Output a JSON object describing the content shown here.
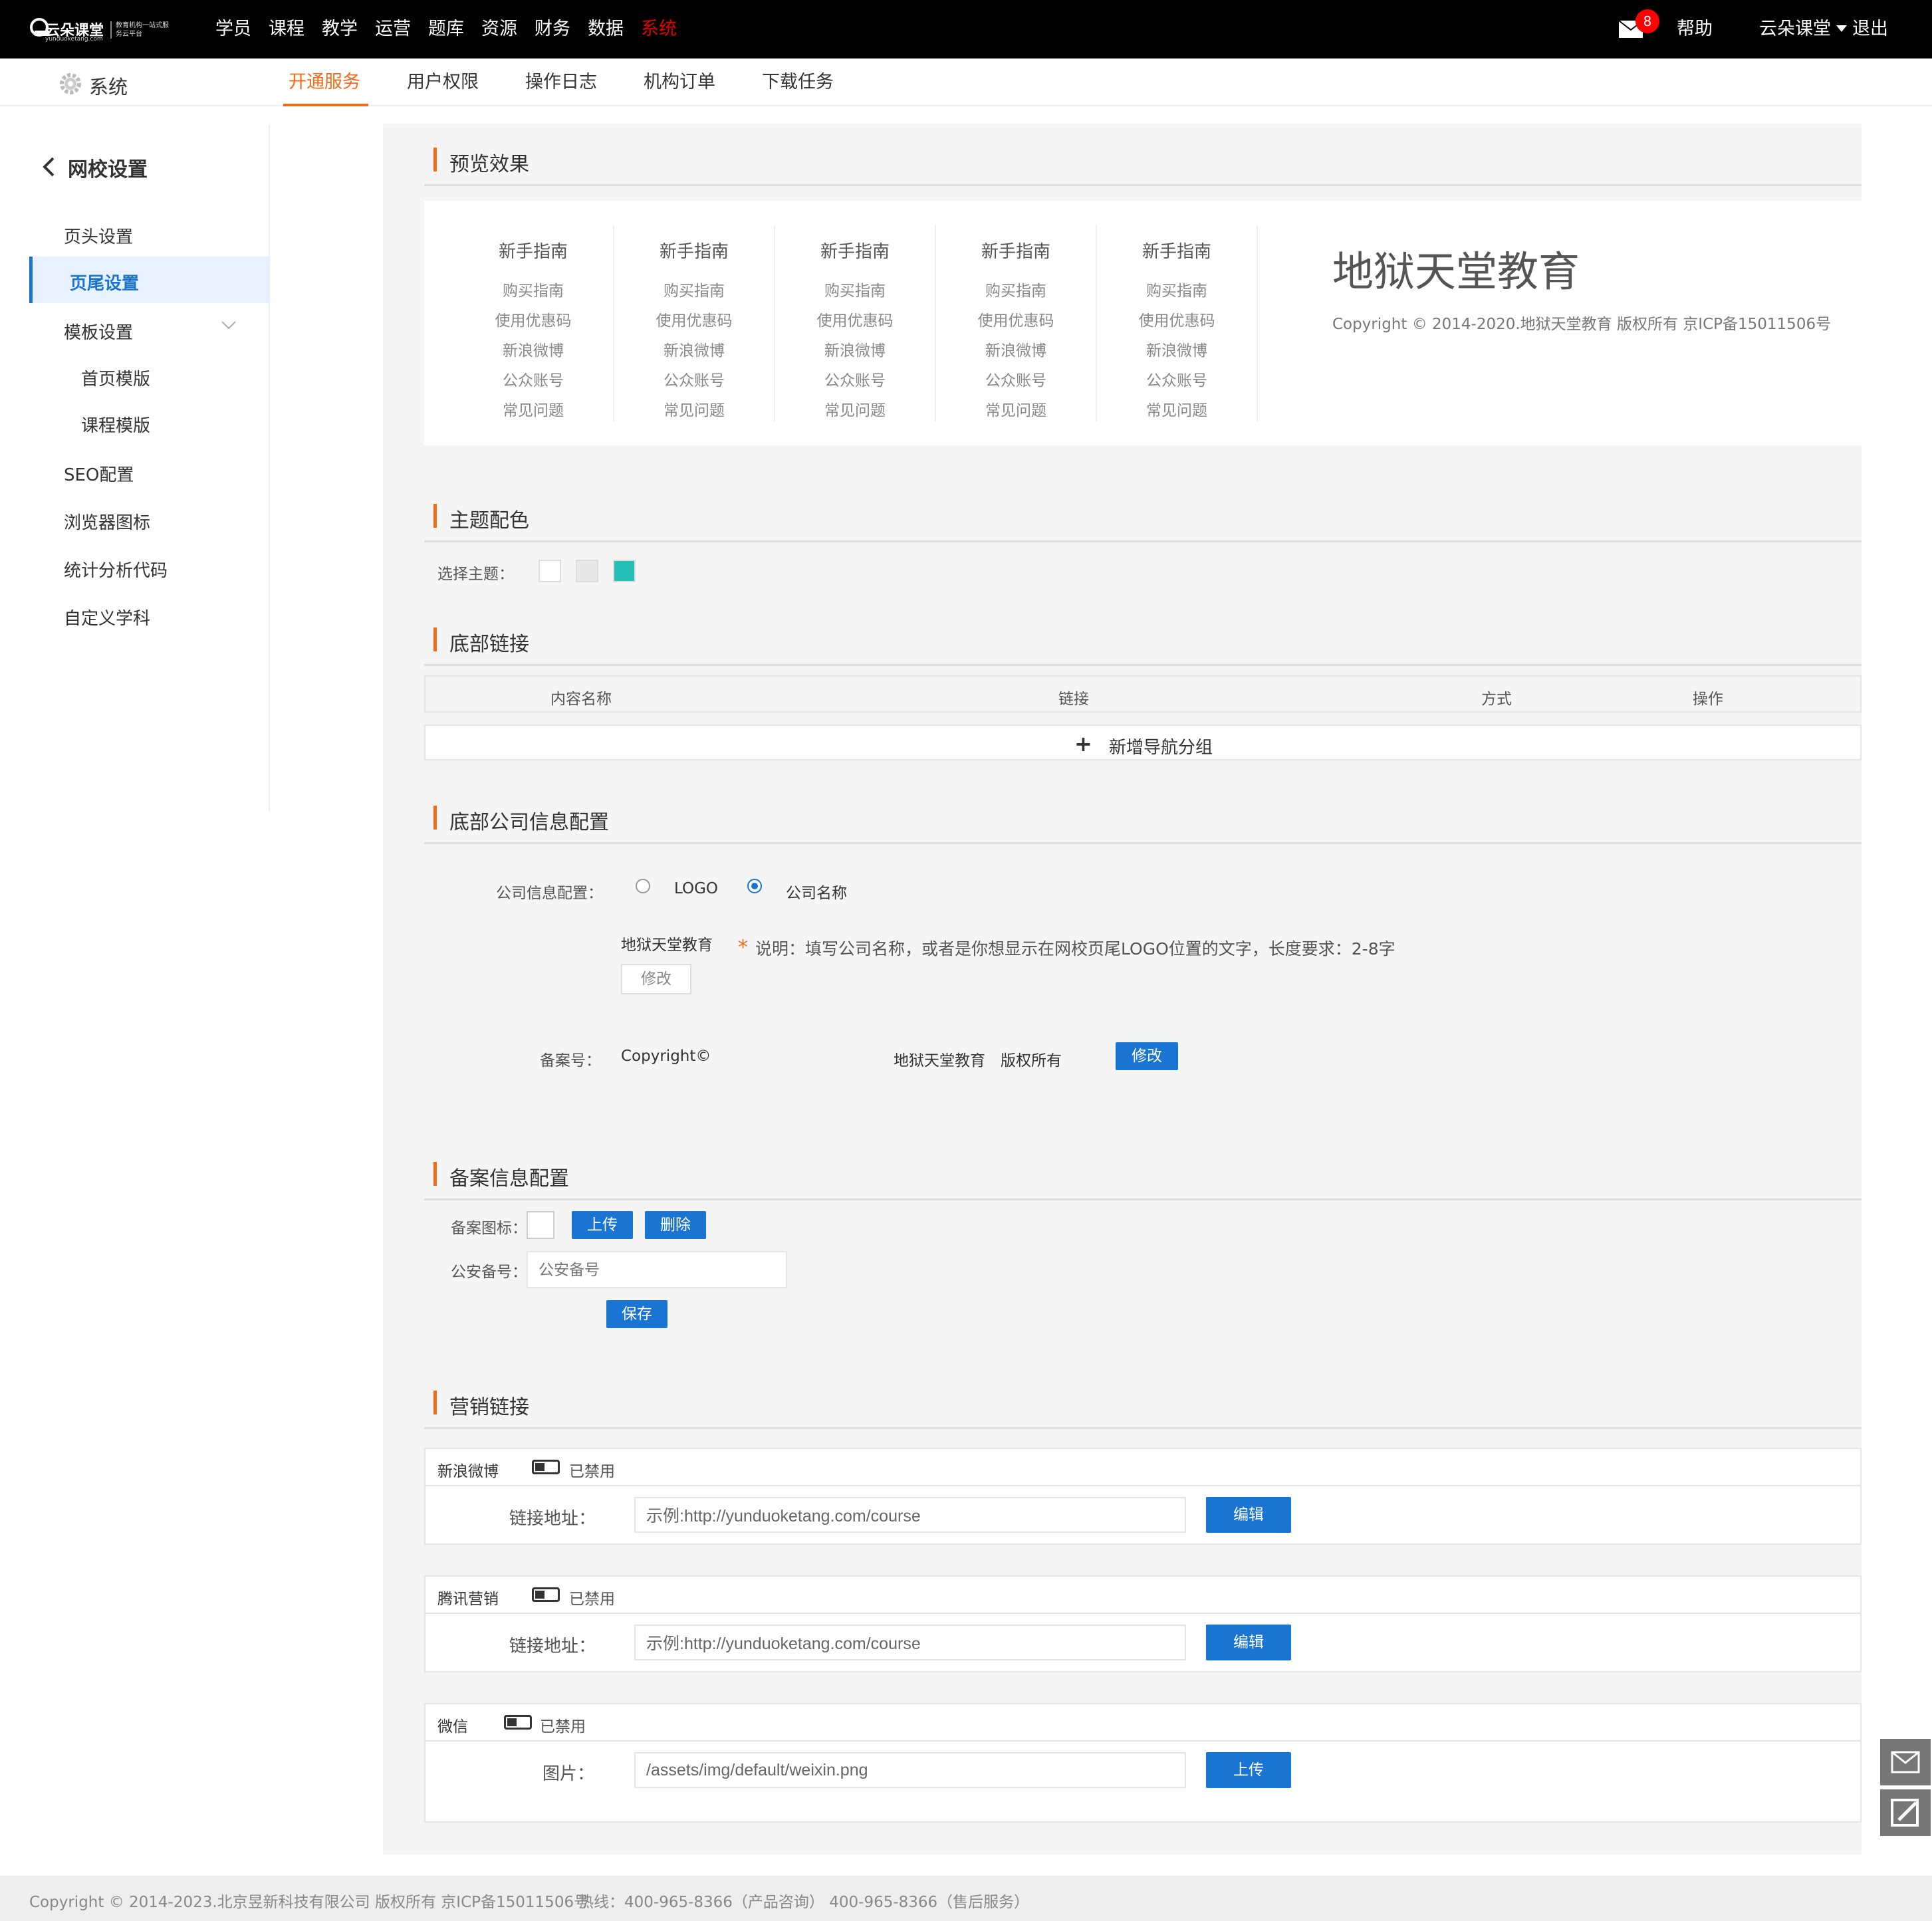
{
  "brand": {
    "name": "云朵课堂",
    "domain": "yunduoketang.com",
    "slogan": "教育机构一站式服务云平台"
  },
  "topnav": {
    "items": [
      "学员",
      "课程",
      "教学",
      "运营",
      "题库",
      "资源",
      "财务",
      "数据",
      "系统"
    ],
    "active": "系统"
  },
  "header": {
    "mail_count": "8",
    "help": "帮助",
    "user": "云朵课堂",
    "logout": "退出"
  },
  "subbar": {
    "title": "系统",
    "tabs": [
      "开通服务",
      "用户权限",
      "操作日志",
      "机构订单",
      "下载任务"
    ],
    "active": "开通服务"
  },
  "sidebar": {
    "back_label": "网校设置",
    "items": [
      "页头设置",
      "页尾设置",
      "模板设置",
      "首页模版",
      "课程模版",
      "SEO配置",
      "浏览器图标",
      "统计分析代码",
      "自定义学科"
    ],
    "active": "页尾设置"
  },
  "sections": {
    "preview": "预览效果",
    "theme": "主题配色",
    "links": "底部链接",
    "company": "底部公司信息配置",
    "record": "备案信息配置",
    "marketing": "营销链接"
  },
  "preview": {
    "columns": [
      {
        "title": "新手指南",
        "links": [
          "购买指南",
          "使用优惠码",
          "新浪微博",
          "公众账号",
          "常见问题"
        ]
      },
      {
        "title": "新手指南",
        "links": [
          "购买指南",
          "使用优惠码",
          "新浪微博",
          "公众账号",
          "常见问题"
        ]
      },
      {
        "title": "新手指南",
        "links": [
          "购买指南",
          "使用优惠码",
          "新浪微博",
          "公众账号",
          "常见问题"
        ]
      },
      {
        "title": "新手指南",
        "links": [
          "购买指南",
          "使用优惠码",
          "新浪微博",
          "公众账号",
          "常见问题"
        ]
      },
      {
        "title": "新手指南",
        "links": [
          "购买指南",
          "使用优惠码",
          "新浪微博",
          "公众账号",
          "常见问题"
        ]
      }
    ],
    "company_name": "地狱天堂教育",
    "copyright": "Copyright © 2014-2020.地狱天堂教育 版权所有 京ICP备15011506号"
  },
  "theme": {
    "label": "选择主题：",
    "colors": [
      "#ffffff",
      "#e8e8e8",
      "#26bfb5"
    ]
  },
  "links_table": {
    "headers": [
      "内容名称",
      "链接",
      "方式",
      "操作"
    ],
    "add_label": "新增导航分组"
  },
  "company": {
    "label": "公司信息配置：",
    "options": [
      "LOGO",
      "公司名称"
    ],
    "selected": "公司名称",
    "name": "地狱天堂教育",
    "edit_label": "修改",
    "note": "说明：填写公司名称，或者是你想显示在网校页尾LOGO位置的文字，长度要求：2-8字",
    "record_label": "备案号：",
    "record_prefix": "Copyright©",
    "record_text": "地狱天堂教育　版权所有",
    "record_edit": "修改"
  },
  "record": {
    "icon_label": "备案图标：",
    "upload": "上传",
    "delete": "删除",
    "police_label": "公安备号：",
    "police_placeholder": "公安备号",
    "save": "保存"
  },
  "marketing": [
    {
      "name": "新浪微博",
      "status": "已禁用",
      "field_label": "链接地址：",
      "value": "示例:http://yunduoketang.com/course",
      "button": "编辑"
    },
    {
      "name": "腾讯营销",
      "status": "已禁用",
      "field_label": "链接地址：",
      "value": "示例:http://yunduoketang.com/course",
      "button": "编辑"
    },
    {
      "name": "微信",
      "status": "已禁用",
      "field_label": "图片：",
      "value": "/assets/img/default/weixin.png",
      "button": "上传"
    }
  ],
  "footer": {
    "copyright": "Copyright © 2014-2023.北京昱新科技有限公司 版权所有 京ICP备15011506号",
    "hotline": "热线：400-965-8366（产品咨询） 400-965-8366（售后服务）"
  }
}
